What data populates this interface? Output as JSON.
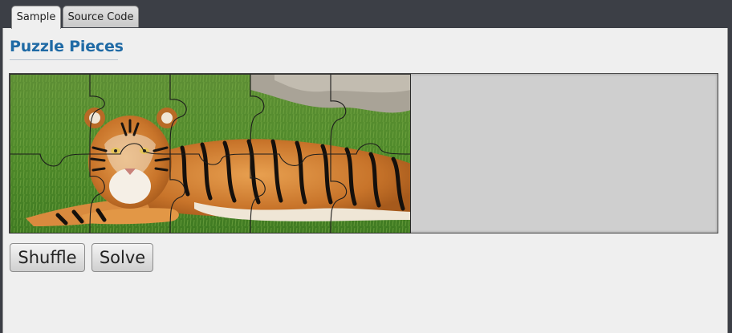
{
  "tabs": [
    {
      "label": "Sample",
      "active": true
    },
    {
      "label": "Source Code",
      "active": false
    }
  ],
  "page": {
    "title": "Puzzle Pieces"
  },
  "buttons": {
    "shuffle": "Shuffle",
    "solve": "Solve"
  },
  "colors": {
    "title": "#1f6aa5",
    "board": "#cfcfcf",
    "window": "#3c3f46",
    "panel": "#efefef"
  },
  "puzzle": {
    "rows": 2,
    "columns": 5,
    "image": "tiger lying on grass"
  }
}
